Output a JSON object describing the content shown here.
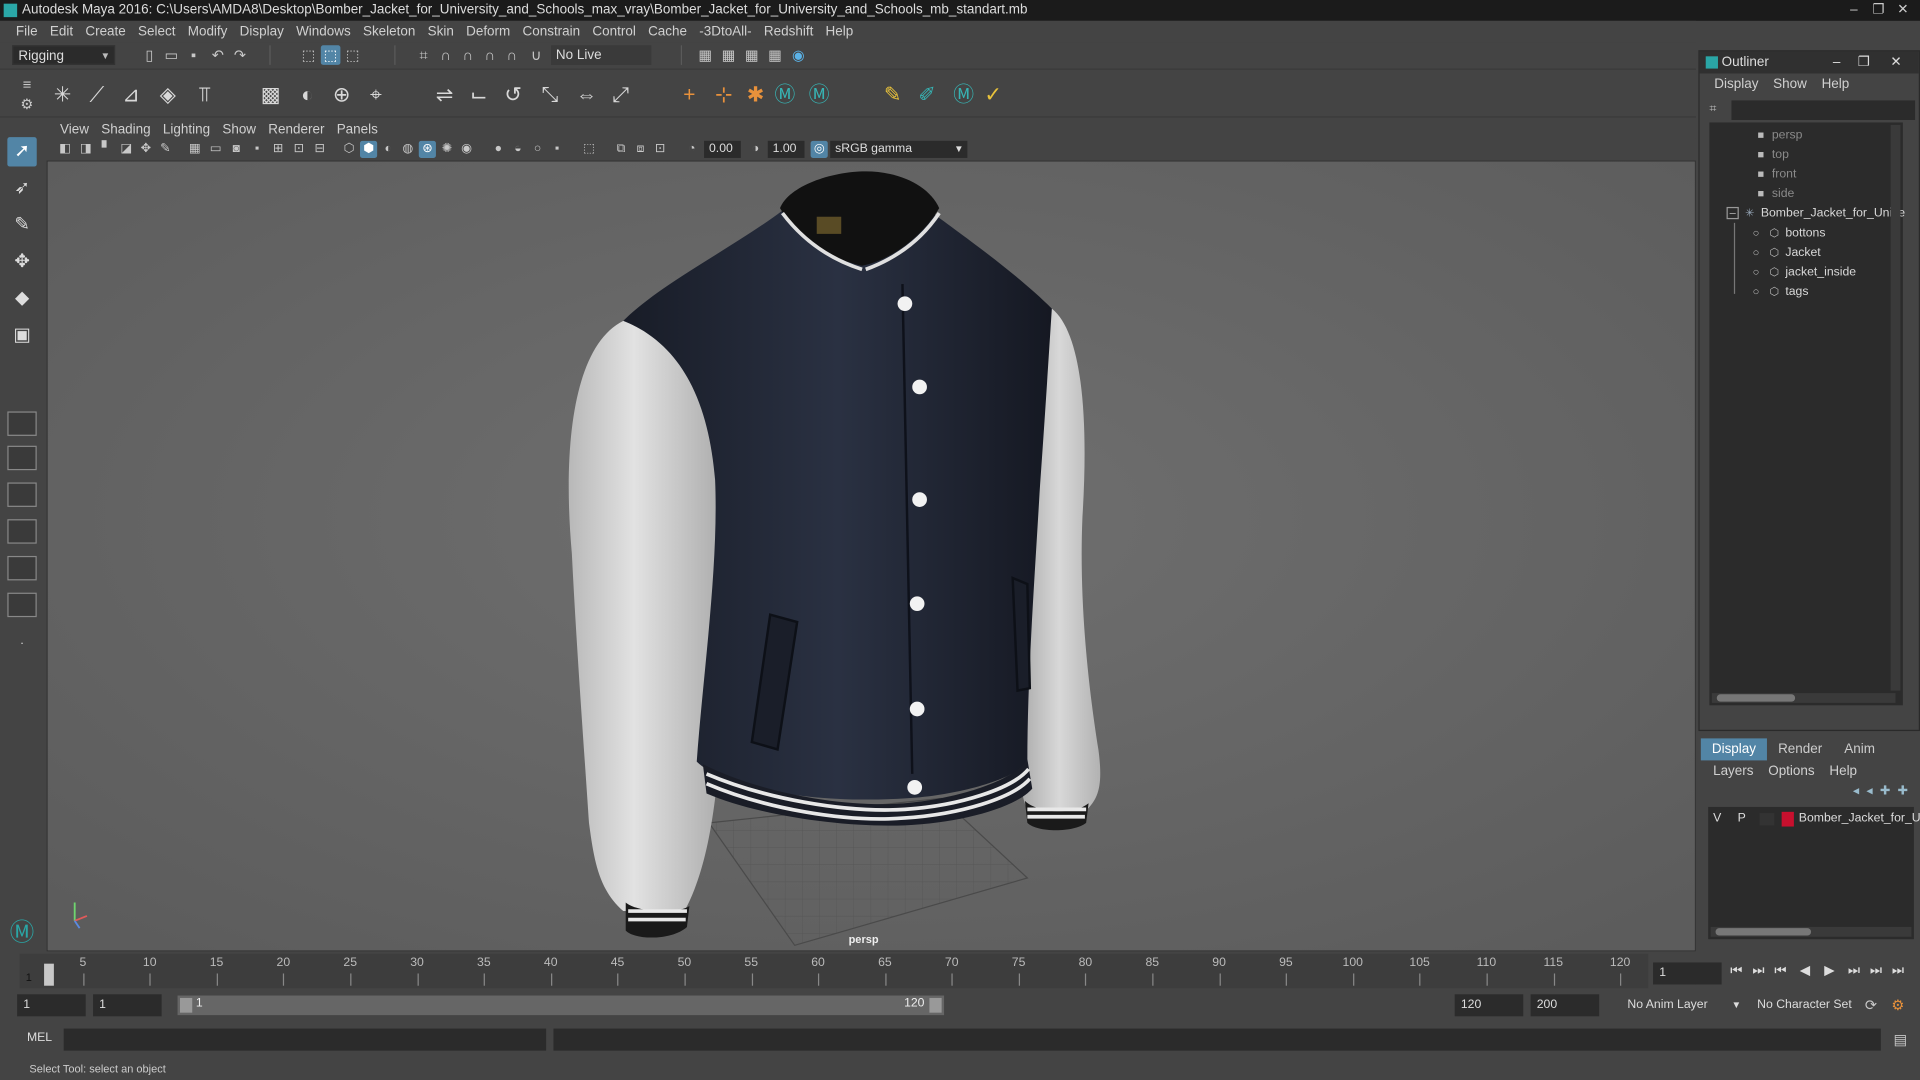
{
  "window": {
    "title": "Autodesk Maya 2016: C:\\Users\\AMDA8\\Desktop\\Bomber_Jacket_for_University_and_Schools_max_vray\\Bomber_Jacket_for_University_and_Schools_mb_standart.mb",
    "controls": [
      "–",
      "❐",
      "✕"
    ]
  },
  "main_menu": [
    "File",
    "Edit",
    "Create",
    "Select",
    "Modify",
    "Display",
    "Windows",
    "Skeleton",
    "Skin",
    "Deform",
    "Constrain",
    "Control",
    "Cache",
    "-3DtoAll-",
    "Redshift",
    "Help"
  ],
  "status_line": {
    "menu_set": "Rigging",
    "live_surface": "No Live Surface"
  },
  "viewport": {
    "menu": [
      "View",
      "Shading",
      "Lighting",
      "Show",
      "Renderer",
      "Panels"
    ],
    "exposure": "0.00",
    "gamma": "1.00",
    "color_space": "sRGB gamma",
    "camera_label": "persp"
  },
  "outliner": {
    "title": "Outliner",
    "menu": [
      "Display",
      "Show",
      "Help"
    ],
    "cameras": [
      "persp",
      "top",
      "front",
      "side"
    ],
    "root": "Bomber_Jacket_for_Unive",
    "children": [
      "bottons",
      "Jacket",
      "jacket_inside",
      "tags"
    ]
  },
  "layer_editor": {
    "tabs": [
      "Display",
      "Render",
      "Anim"
    ],
    "active_tab": "Display",
    "menu": [
      "Layers",
      "Options",
      "Help"
    ],
    "layer": {
      "visible": "V",
      "playback": "P",
      "name": "Bomber_Jacket_for_Ur",
      "color": "#c8102e"
    }
  },
  "time_slider": {
    "ticks": [
      "5",
      "10",
      "15",
      "20",
      "25",
      "30",
      "35",
      "40",
      "45",
      "50",
      "55",
      "60",
      "65",
      "70",
      "75",
      "80",
      "85",
      "90",
      "95",
      "100",
      "105",
      "110",
      "115",
      "120"
    ],
    "playhead_label": "1",
    "current_frame": "1"
  },
  "range_slider": {
    "start_time": "1",
    "playback_start": "1",
    "range_start": "1",
    "range_end": "120",
    "playback_end": "120",
    "end_time": "200",
    "anim_layer": "No Anim Layer",
    "character_set": "No Character Set"
  },
  "command_line": {
    "language": "MEL"
  },
  "help_line": {
    "text": "Select Tool: select an object"
  },
  "colors": {
    "accent": "#5285a6",
    "jacket_body": "#1f2433",
    "sleeves": "#cfcfcf"
  }
}
